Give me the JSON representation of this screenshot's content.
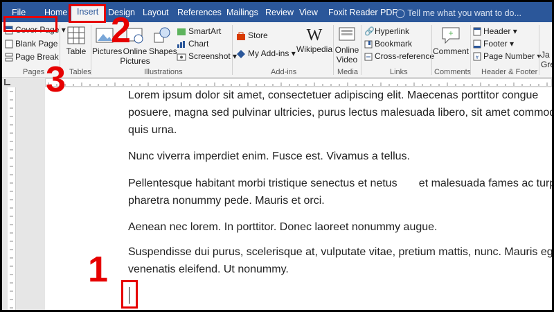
{
  "tabs": [
    "File",
    "Home",
    "Insert",
    "Design",
    "Layout",
    "References",
    "Mailings",
    "Review",
    "View",
    "Foxit Reader PDF"
  ],
  "tell_me": "Tell me what you want to do...",
  "ribbon": {
    "pages": {
      "cover_page": "Cover Page",
      "blank_page": "Blank Page",
      "page_break": "Page Break",
      "label": "Pages"
    },
    "tables": {
      "table": "Table",
      "label": "Tables"
    },
    "illustrations": {
      "pictures": "Pictures",
      "online_pictures_1": "Online",
      "online_pictures_2": "Pictures",
      "shapes": "Shapes",
      "smartart": "SmartArt",
      "chart": "Chart",
      "screenshot": "Screenshot",
      "label": "Illustrations"
    },
    "addins": {
      "store": "Store",
      "my_addins": "My Add-ins",
      "wikipedia": "Wikipedia",
      "label": "Add-ins"
    },
    "media": {
      "online_video_1": "Online",
      "online_video_2": "Video",
      "label": "Media"
    },
    "links": {
      "hyperlink": "Hyperlink",
      "bookmark": "Bookmark",
      "cross_reference": "Cross-reference",
      "label": "Links"
    },
    "comments": {
      "comment": "Comment",
      "label": "Comments"
    },
    "header_footer": {
      "header": "Header",
      "footer": "Footer",
      "page_number": "Page Number",
      "label": "Header & Footer"
    },
    "cutoff": {
      "line1": "Ja",
      "line2": "Gre"
    }
  },
  "document": {
    "lines": [
      "Lorem ipsum dolor sit amet, consectetuer adipiscing elit. Maecenas porttitor congue",
      "posuere, magna sed pulvinar ultricies, purus lectus malesuada libero, sit amet commodo",
      "quis urna.",
      "Nunc viverra imperdiet enim. Fusce est. Vivamus a tellus.",
      "Pellentesque habitant morbi tristique senectus et netus       et malesuada fames ac turpis",
      "pharetra nonummy pede. Mauris et orci.",
      "Aenean nec lorem. In porttitor. Donec laoreet nonummy augue.",
      "Suspendisse dui purus, scelerisque at, vulputate vitae, pretium mattis, nunc. Mauris eget",
      "venenatis eleifend. Ut nonummy."
    ]
  },
  "annotations": {
    "step1": "1",
    "step2": "2",
    "step3": "3"
  },
  "colors": {
    "ribbon_blue": "#2b579a",
    "annotation_red": "#e60000"
  }
}
